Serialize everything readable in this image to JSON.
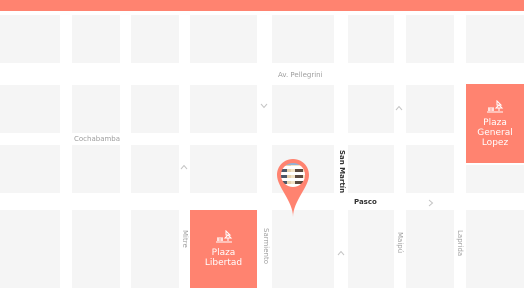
{
  "colors": {
    "accent": "#ff8370",
    "block": "#f5f5f5",
    "road": "#ffffff",
    "street_label": "#9e9e9e",
    "street_label_dark": "#333333",
    "arrow": "#c4c4c4"
  },
  "plazas": [
    {
      "id": "plaza-general-lopez",
      "label": "Plaza\nGeneral\nLopez",
      "icon": "park-icon"
    },
    {
      "id": "plaza-libertad",
      "label": "Plaza\nLibertad",
      "icon": "park-icon"
    }
  ],
  "streets": {
    "pellegrini": "Av. Pellegrini",
    "cochabamba": "Cochabamba",
    "san_martin": "San Martín",
    "pasco": "Pasco",
    "mitre": "Mitre",
    "sarmiento": "Sarmiento",
    "maipu": "Maipú",
    "laprida": "Laprida"
  },
  "marker": {
    "icon": "location-pin-icon",
    "image": "building-photo"
  }
}
